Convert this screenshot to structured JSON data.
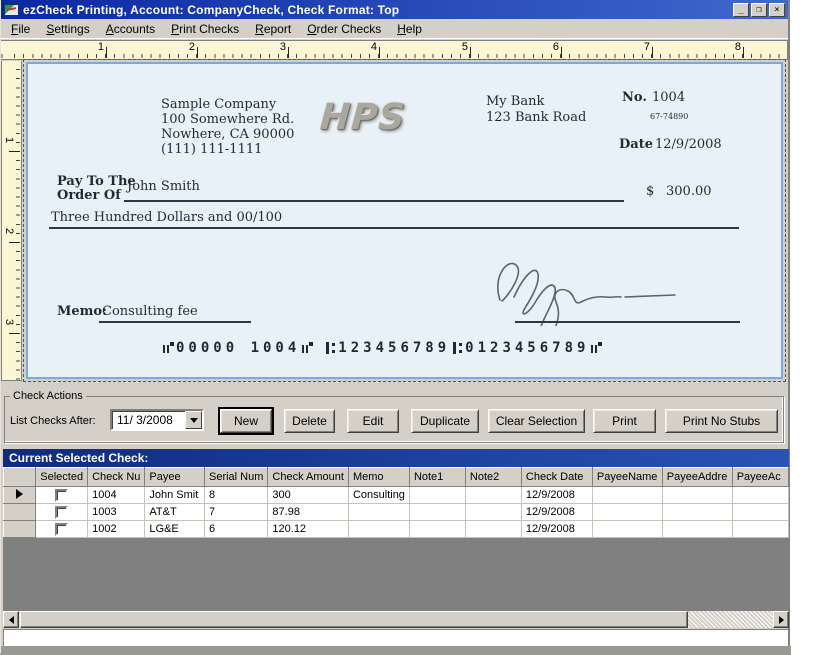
{
  "window": {
    "title": "ezCheck Printing, Account: CompanyCheck, Check Format: Top",
    "controls": {
      "minimize": "_",
      "restore": "❐",
      "close": "×"
    }
  },
  "menu": {
    "items": [
      "File",
      "Settings",
      "Accounts",
      "Print Checks",
      "Report",
      "Order Checks",
      "Help"
    ]
  },
  "rulers": {
    "horizontal": [
      "1",
      "2",
      "3",
      "4",
      "5",
      "6",
      "7",
      "8"
    ],
    "vertical": [
      "1",
      "2",
      "3"
    ]
  },
  "check": {
    "company": {
      "name": "Sample Company",
      "address1": "100 Somewhere Rd.",
      "address2": "Nowhere, CA 90000",
      "phone": "(111) 111-1111"
    },
    "logo_text": "HPS",
    "bank": {
      "name": "My Bank",
      "address": "123 Bank Road"
    },
    "number_label": "No.",
    "number": "1004",
    "fraction": "67-74890",
    "date_label": "Date",
    "date": "12/9/2008",
    "pay_to_line1": "Pay To The",
    "pay_to_line2": "Order Of",
    "payee": "John Smith",
    "dollar_sign": "$",
    "amount": "300.00",
    "amount_words": "Three Hundred  Dollars and 00/100",
    "memo_label": "Memo:",
    "memo": "Consulting fee",
    "micr": {
      "seg1": "00000 1004",
      "seg2": "123456789",
      "seg3": "0123456789"
    }
  },
  "actions": {
    "group_title": "Check Actions",
    "list_checks_after_label": "List Checks After:",
    "date_filter": "11/ 3/2008",
    "buttons": [
      "New",
      "Delete",
      "Edit",
      "Duplicate",
      "Clear Selection",
      "Print",
      "Print No Stubs"
    ]
  },
  "selected_section": {
    "title": "Current Selected Check:"
  },
  "grid": {
    "headers": [
      "Selected",
      "Check Nu",
      "Payee",
      "Serial Num",
      "Check Amount",
      "Memo",
      "Note1",
      "Note2",
      "Check Date",
      "PayeeName",
      "PayeeAddre",
      "PayeeAc"
    ],
    "rows": [
      {
        "check_number": "1004",
        "payee": "John Smit",
        "serial": "8",
        "amount": "300",
        "memo": "Consulting",
        "note1": "",
        "note2": "",
        "check_date": "12/9/2008",
        "payee_name": "",
        "payee_addr": "",
        "payee_ac": ""
      },
      {
        "check_number": "1003",
        "payee": "AT&T",
        "serial": "7",
        "amount": "87.98",
        "memo": "",
        "note1": "",
        "note2": "",
        "check_date": "12/9/2008",
        "payee_name": "",
        "payee_addr": "",
        "payee_ac": ""
      },
      {
        "check_number": "1002",
        "payee": "LG&E",
        "serial": "6",
        "amount": "120.12",
        "memo": "",
        "note1": "",
        "note2": "",
        "check_date": "12/9/2008",
        "payee_name": "",
        "payee_addr": "",
        "payee_ac": ""
      }
    ]
  },
  "colors": {
    "titlebar_start": "#0b28a2",
    "titlebar_end": "#3f68cc",
    "section_bar": "#0e2b80",
    "check_bg": "#e9f1f8",
    "check_border": "#7fa7d9",
    "ruler_bg": "#fbf7d5",
    "face": "#d4d0c8",
    "grid_empty": "#808080"
  }
}
